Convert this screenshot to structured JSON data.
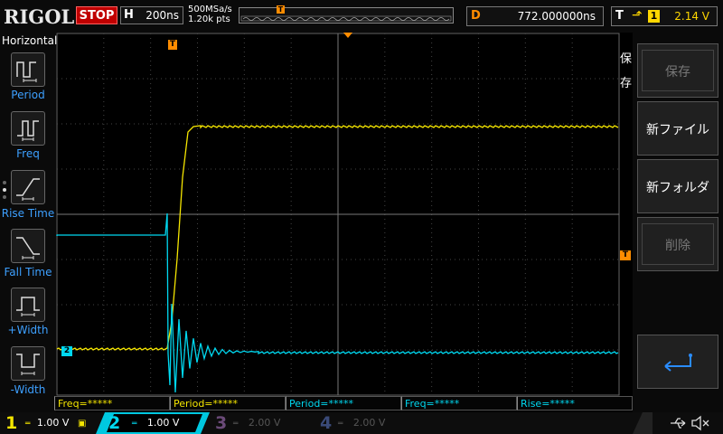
{
  "top": {
    "logo": "RIGOL",
    "run_state": "STOP",
    "horizontal_key": "H",
    "timebase": "200ns",
    "sample_rate": "500MSa/s",
    "memory_depth": "1.20k pts",
    "delay_key": "D",
    "delay": "772.000000ns",
    "trigger_key": "T",
    "trigger_source": "1",
    "trigger_level": "2.14 V"
  },
  "left_menu": {
    "title": "Horizontal",
    "items": [
      {
        "label": "Period",
        "icon": "period-icon"
      },
      {
        "label": "Freq",
        "icon": "frequency-icon"
      },
      {
        "label": "Rise Time",
        "icon": "rise-time-icon"
      },
      {
        "label": "Fall Time",
        "icon": "fall-time-icon"
      },
      {
        "label": "+Width",
        "icon": "positive-width-icon"
      },
      {
        "label": "-Width",
        "icon": "negative-width-icon"
      }
    ]
  },
  "right_menu": {
    "title": "保存",
    "buttons": [
      {
        "label": "保存",
        "enabled": false
      },
      {
        "label": "新ファイル",
        "enabled": true
      },
      {
        "label": "新フォルダ",
        "enabled": true
      },
      {
        "label": "削除",
        "enabled": false
      },
      {
        "label": "",
        "icon": "return-icon",
        "enabled": true
      }
    ]
  },
  "measurements": [
    "Freq=*****",
    "Period=*****",
    "Period=*****",
    "Freq=*****",
    "Rise=*****"
  ],
  "channels": [
    {
      "num": "1",
      "scale": "1.00 V",
      "color": "#f5e600",
      "active": true
    },
    {
      "num": "2",
      "scale": "1.00 V",
      "color": "#00d8f0",
      "active": true
    },
    {
      "num": "3",
      "scale": "2.00 V",
      "color": "#6a4a78",
      "active": false
    },
    {
      "num": "4",
      "scale": "2.00 V",
      "color": "#3a4a78",
      "active": false
    }
  ],
  "markers": {
    "ch2": "2",
    "trigger": "T"
  },
  "status_icons": [
    "usb-icon",
    "speaker-muted-icon"
  ],
  "colors": {
    "ch1": "#f5e600",
    "ch2": "#00d8f0",
    "trigger": "#ff8c00",
    "menu_text": "#3da0ff"
  }
}
